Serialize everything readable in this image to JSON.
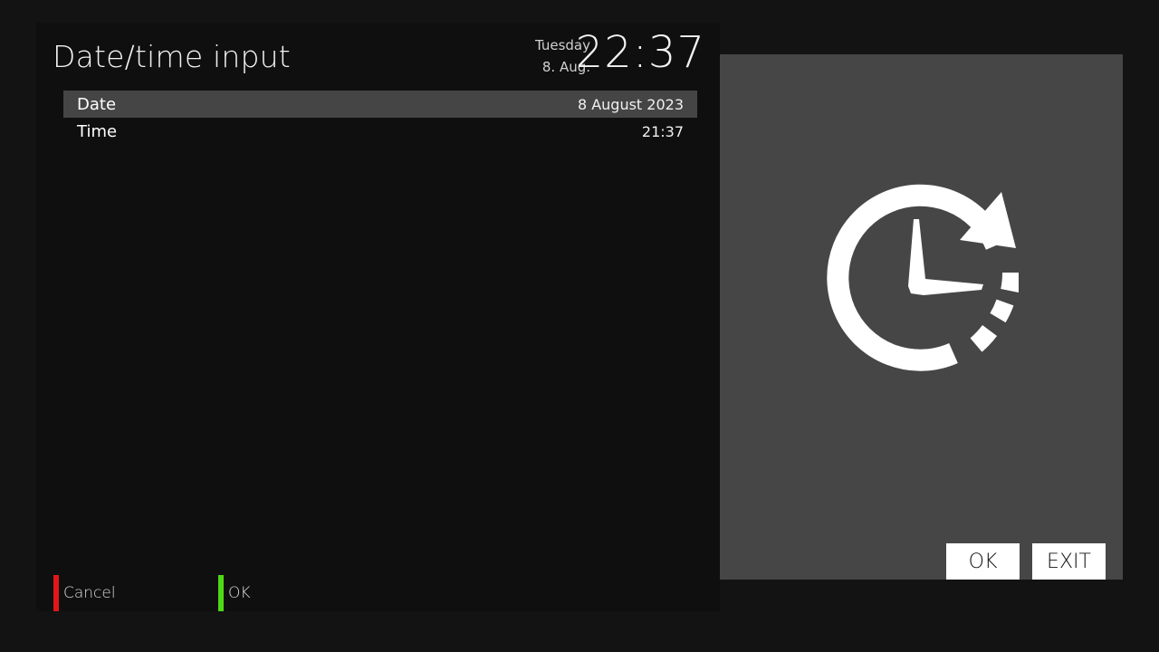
{
  "header": {
    "title": "Date/time input",
    "clock_day": "Tuesday",
    "clock_date": "8. Aug.",
    "clock_time": "22:37"
  },
  "menu": {
    "items": [
      {
        "label": "Date",
        "value": "8 August 2023",
        "selected": true
      },
      {
        "label": "Time",
        "value": "21:37",
        "selected": false
      }
    ]
  },
  "footer": {
    "red_label": "Cancel",
    "green_label": "OK",
    "red_color": "#e01818",
    "green_color": "#4fd814"
  },
  "side": {
    "icon": "clock-update-icon",
    "ok_label": "OK",
    "exit_label": "EXIT"
  }
}
